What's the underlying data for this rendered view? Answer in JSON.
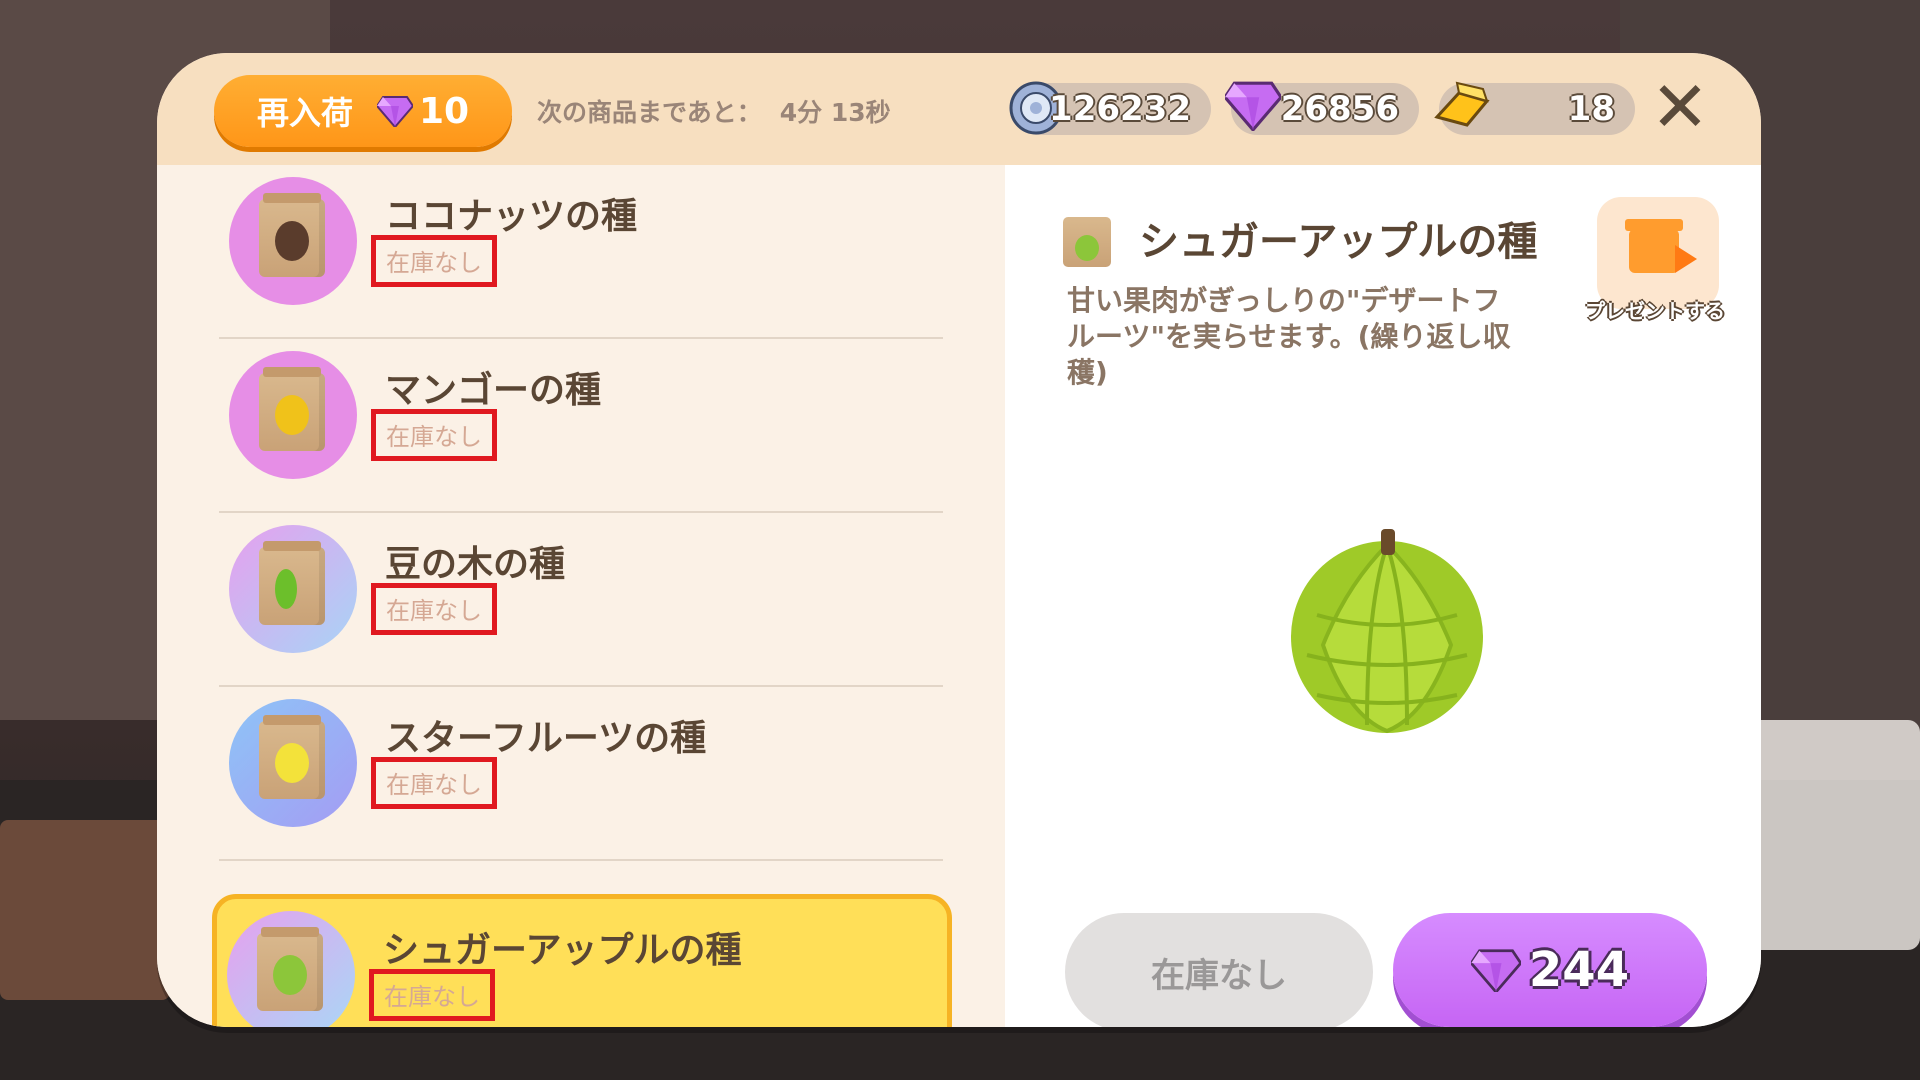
{
  "topbar": {
    "restock_label": "再入荷",
    "restock_cost": "10",
    "timer_label": "次の商品まであと：",
    "timer_value": "4分 13秒",
    "currencies": [
      {
        "icon": "coin-icon",
        "value": "126232"
      },
      {
        "icon": "gem-icon",
        "value": "26856"
      },
      {
        "icon": "gold-bar-icon",
        "value": "18"
      }
    ],
    "close_icon": "close-icon"
  },
  "items": [
    {
      "name": "ココナッツの種",
      "stock": "在庫なし",
      "circle_color": "#e68ee6",
      "seed_color": "#5a3c2c"
    },
    {
      "name": "マンゴーの種",
      "stock": "在庫なし",
      "circle_color": "#e68ee6",
      "seed_color": "#f0c21a"
    },
    {
      "name": "豆の木の種",
      "stock": "在庫なし",
      "circle_color": "#b6a8f2",
      "seed_color": "#6cbf2b"
    },
    {
      "name": "スターフルーツの種",
      "stock": "在庫なし",
      "circle_color": "#9aaaf8",
      "seed_color": "#f3e23a"
    },
    {
      "name": "シュガーアップルの種",
      "stock": "在庫なし",
      "circle_color": "#b8c8f4",
      "seed_color": "#8cc63a"
    }
  ],
  "detail": {
    "title": "シュガーアップルの種",
    "description": "甘い果肉がぎっしりの\"デザートフルーツ\"を実らせます。(繰り返し収穫)",
    "gift_label": "プレゼントする",
    "out_of_stock_label": "在庫なし",
    "price": "244"
  },
  "colors": {
    "accent_orange": "#ff9c1a",
    "accent_purple": "#c665f4",
    "highlight_yellow": "#ffdf58",
    "stock_border_red": "#e01920"
  }
}
